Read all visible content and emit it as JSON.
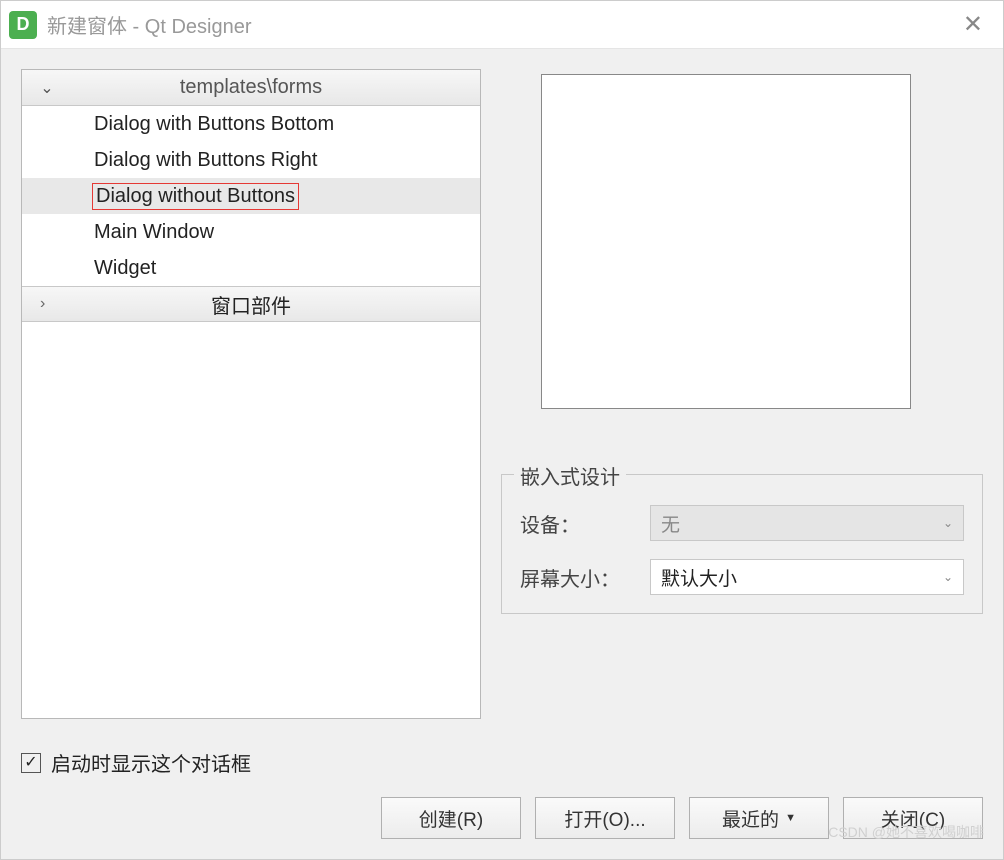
{
  "window": {
    "title": "新建窗体 - Qt Designer",
    "app_icon_letter": "D",
    "close_glyph": "✕"
  },
  "tree": {
    "header": {
      "chevron": "⌄",
      "label": "templates\\forms"
    },
    "items": [
      {
        "label": "Dialog with Buttons Bottom",
        "selected": false,
        "highlighted": false
      },
      {
        "label": "Dialog with Buttons Right",
        "selected": false,
        "highlighted": false
      },
      {
        "label": "Dialog without Buttons",
        "selected": true,
        "highlighted": true
      },
      {
        "label": "Main Window",
        "selected": false,
        "highlighted": false
      },
      {
        "label": "Widget",
        "selected": false,
        "highlighted": false
      }
    ],
    "collapsed_section": {
      "chevron": "›",
      "label": "窗口部件"
    }
  },
  "embed": {
    "group_title": "嵌入式设计",
    "device_label": "设备：",
    "device_value": "无",
    "screen_label": "屏幕大小：",
    "screen_value": "默认大小"
  },
  "checkbox": {
    "checked_glyph": "✓",
    "label": "启动时显示这个对话框"
  },
  "buttons": {
    "create": "创建(R)",
    "open": "打开(O)...",
    "recent": "最近的",
    "close": "关闭(C)",
    "dropdown_glyph": "▼"
  },
  "watermark": "CSDN @她不喜欢喝咖啡"
}
